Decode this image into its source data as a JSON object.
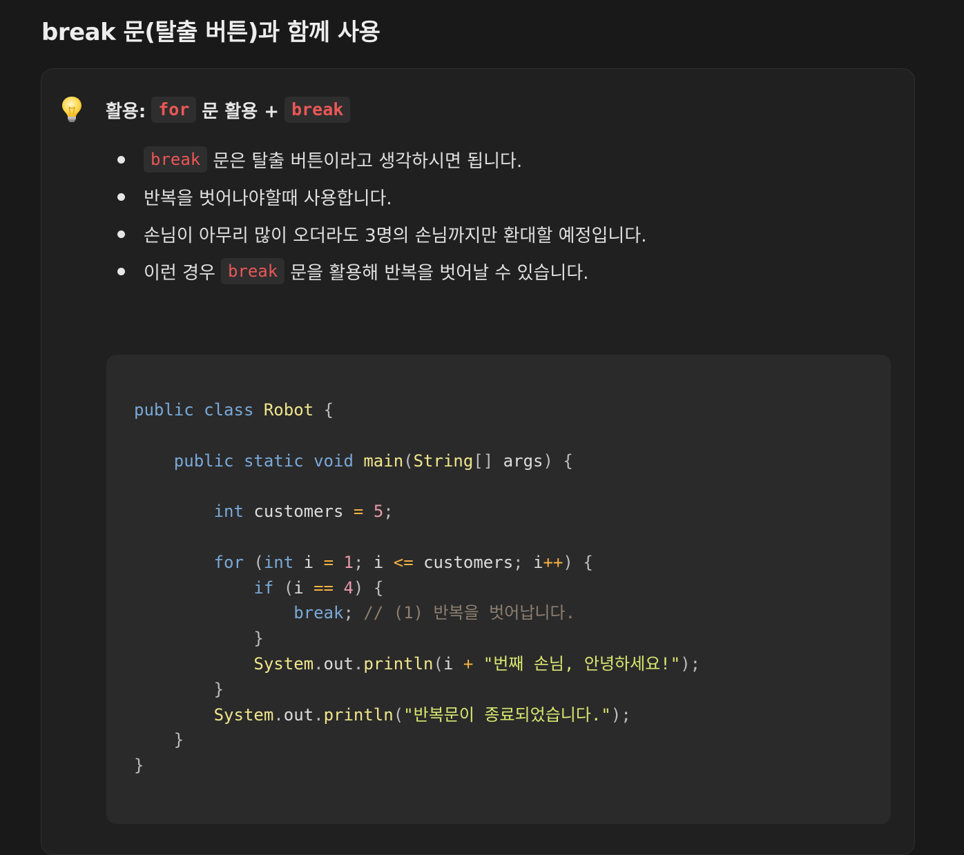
{
  "heading": "break 문(탈출 버튼)과 함께 사용",
  "callout": {
    "icon": "lightbulb-icon",
    "title": {
      "prefix": "활용:",
      "code1": "for",
      "middle": "문 활용 +",
      "code2": "break"
    },
    "bullets": [
      {
        "code": "break",
        "text": "문은 탈출 버튼이라고 생각하시면 됩니다."
      },
      {
        "text": "반복을 벗어나야할때 사용합니다."
      },
      {
        "text": "손님이 아무리 많이 오더라도 3명의 손님까지만 환대할 예정입니다."
      },
      {
        "before": "이런 경우",
        "code": "break",
        "after": "문을 활용해 반복을 벗어날 수 있습니다."
      }
    ]
  },
  "code": {
    "language": "java",
    "lines": [
      "public class Robot {",
      "",
      "    public static void main(String[] args) {",
      "",
      "        int customers = 5;",
      "",
      "        for (int i = 1; i <= customers; i++) {",
      "            if (i == 4) {",
      "                break; // (1) 반복을 벗어납니다.",
      "            }",
      "            System.out.println(i + \"번째 손님, 안녕하세요!\");",
      "        }",
      "        System.out.println(\"반복문이 종료되었습니다.\");",
      "    }",
      "}"
    ]
  },
  "colors": {
    "background": "#191919",
    "callout_bg": "#202020",
    "code_bg": "#2a2a2a",
    "inline_code": "#eb5757",
    "keyword": "#7aa9d8",
    "string": "#d9e870",
    "number": "#e79ab0",
    "comment": "#8c7f70"
  }
}
